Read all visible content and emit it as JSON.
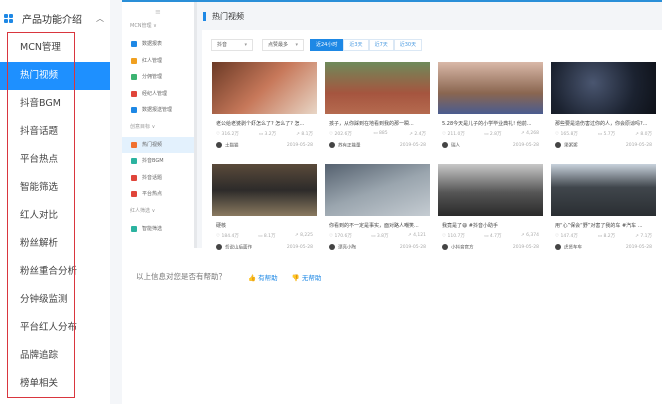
{
  "sidebar": {
    "heading": "产品功能介绍",
    "items": [
      "MCN管理",
      "热门视频",
      "抖音BGM",
      "抖音话题",
      "平台热点",
      "智能筛选",
      "红人对比",
      "粉丝解析",
      "粉丝重合分析",
      "分钟级监测",
      "平台红人分布",
      "品牌追踪",
      "榜单相关"
    ],
    "active_index": 1
  },
  "inner_sidebar": {
    "groups": [
      {
        "label": "MCN管理 ∨",
        "items": [
          "数据报表",
          "红人管理",
          "分佣管理",
          "经纪人管理",
          "数据报送管理"
        ]
      },
      {
        "label": "创意目标 ∨",
        "items": [
          "热门视频",
          "抖音BGM",
          "抖音话题",
          "平台热点"
        ]
      },
      {
        "label": "红人筛选 ∨",
        "items": [
          "智能筛选"
        ]
      }
    ]
  },
  "content": {
    "title": "热门视频",
    "filters": {
      "platform": "抖音",
      "sort": "点赞最多",
      "tabs": [
        "近24小时",
        "近3天",
        "近7天",
        "近30天"
      ],
      "active_tab": 0
    },
    "cards": [
      {
        "title": "老公给老婆剥个虾怎么了? 怎么了? 怎...",
        "likes": "316.2万",
        "comments": "3.2万",
        "shares": "8.1万",
        "author": "土猫猫",
        "date": "2019-05-28"
      },
      {
        "title": "孩子，从你踩到在地看到我的那一瞬...",
        "likes": "202.6万",
        "comments": "885",
        "shares": "2.4万",
        "author": "苏有正能量",
        "date": "2019-05-28"
      },
      {
        "title": "5.28今天是儿子的小学毕业典礼! 他前...",
        "likes": "211.0万",
        "comments": "2.8万",
        "shares": "4,268",
        "author": "瑞人",
        "date": "2019-05-28"
      },
      {
        "title": "那些要是造伤害过你的人，你会原谅吗?...",
        "likes": "165.8万",
        "comments": "5.7万",
        "shares": "8.0万",
        "author": "果粥粥",
        "date": "2019-05-28"
      },
      {
        "title": "硬核",
        "likes": "184.4万",
        "comments": "8.1万",
        "shares": "8,225",
        "author": "哲说山后面作",
        "date": "2019-05-28"
      },
      {
        "title": "你看到的不一定是事实，面对路人嘲笑...",
        "likes": "170.6万",
        "comments": "3.8万",
        "shares": "4,121",
        "author": "漂亮小陶",
        "date": "2019-05-28"
      },
      {
        "title": "我竟是了😄 #抖音小助手",
        "likes": "110.7万",
        "comments": "4.7万",
        "shares": "6,374",
        "author": "小抖音官方",
        "date": "2019-05-28"
      },
      {
        "title": "用“心”保会“野”对害了我的车 #汽车 ...",
        "likes": "147.4万",
        "comments": "8.2万",
        "shares": "7.1万",
        "author": "虎贤车车",
        "date": "2019-05-28"
      }
    ]
  },
  "feedback": {
    "question": "以上信息对您是否有帮助？",
    "yes": "有帮助",
    "no": "无帮助"
  },
  "colors": {
    "accent": "#1e90ff",
    "highlight_box": "#d9363e"
  }
}
